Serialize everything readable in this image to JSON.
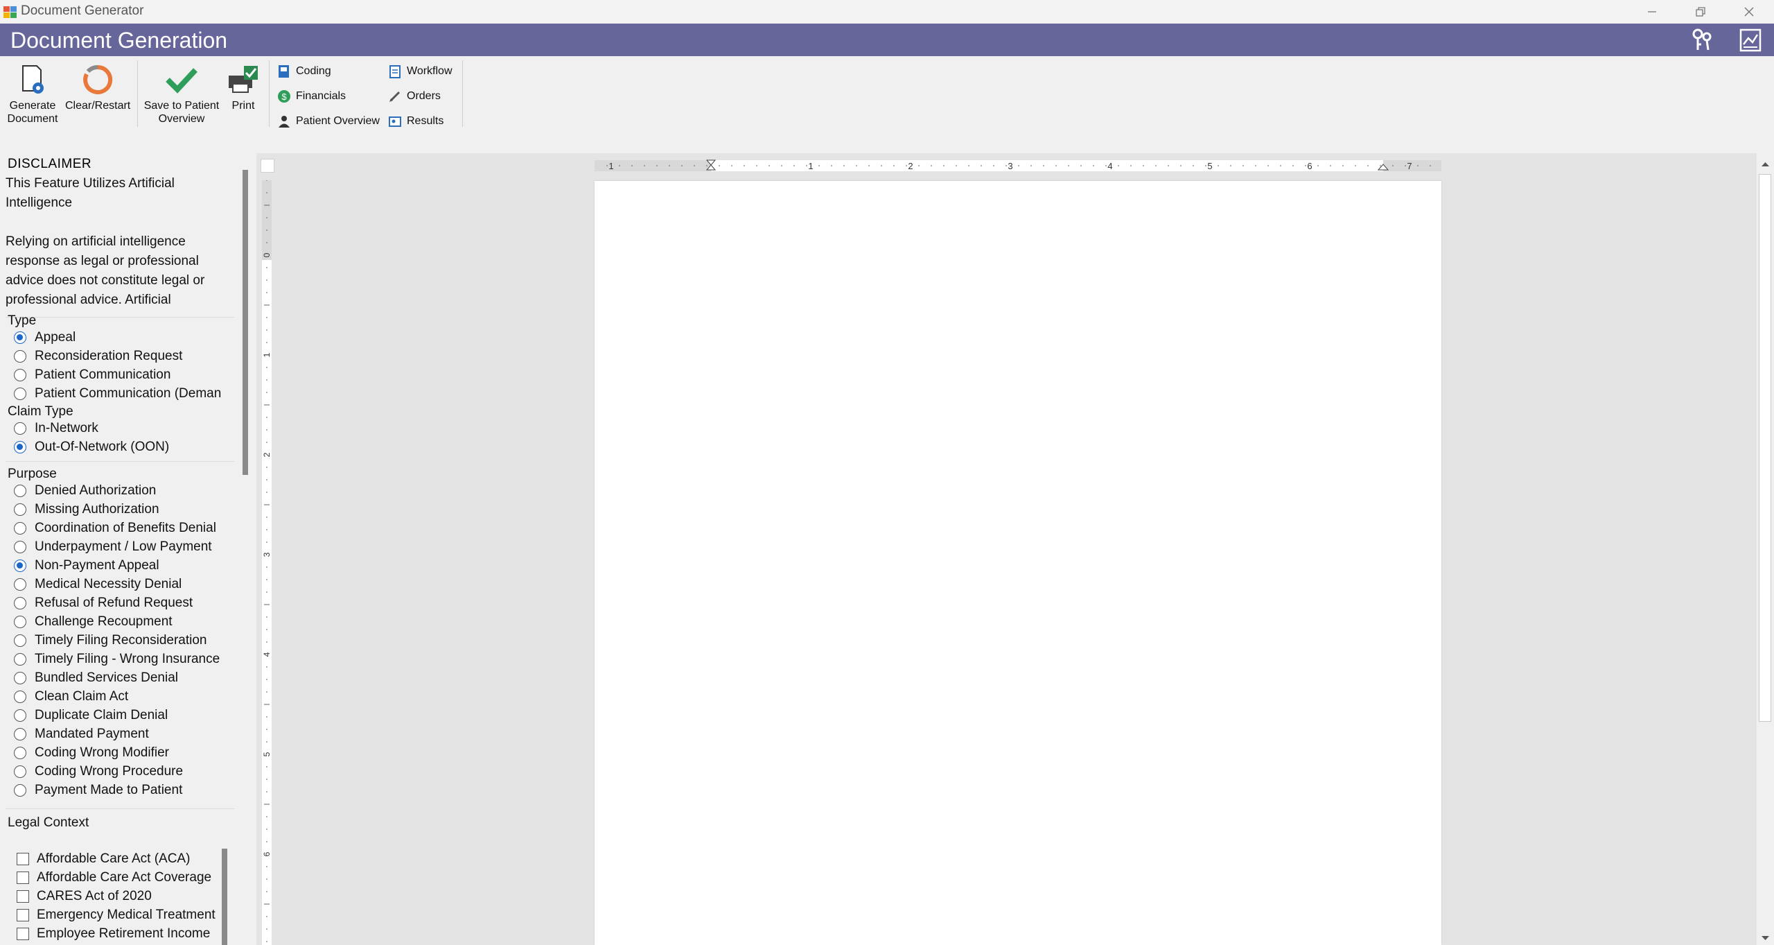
{
  "window": {
    "title": "Document Generator"
  },
  "header": {
    "title": "Document Generation"
  },
  "toolbar": {
    "generate_label": "Generate\nDocument",
    "clear_label": "Clear/Restart",
    "save_label": "Save to Patient\nOverview",
    "print_label": "Print",
    "links": {
      "coding": "Coding",
      "financials": "Financials",
      "patient_overview": "Patient Overview",
      "workflow": "Workflow",
      "orders": "Orders",
      "results": "Results"
    }
  },
  "disclaimer": {
    "heading": "DISCLAIMER",
    "text": "This Feature Utilizes Artificial Intelligence\n\nRelying on artificial intelligence response as legal or professional advice does not constitute legal or professional advice. Artificial"
  },
  "type": {
    "label": "Type",
    "options": [
      {
        "label": "Appeal",
        "selected": true
      },
      {
        "label": "Reconsideration Request",
        "selected": false
      },
      {
        "label": "Patient Communication",
        "selected": false
      },
      {
        "label": "Patient Communication (Deman",
        "selected": false
      }
    ]
  },
  "claim_type": {
    "label": "Claim Type",
    "options": [
      {
        "label": "In-Network",
        "selected": false
      },
      {
        "label": "Out-Of-Network (OON)",
        "selected": true
      }
    ]
  },
  "purpose": {
    "label": "Purpose",
    "options": [
      {
        "label": "Denied Authorization",
        "selected": false
      },
      {
        "label": "Missing Authorization",
        "selected": false
      },
      {
        "label": "Coordination of Benefits Denial",
        "selected": false
      },
      {
        "label": "Underpayment / Low Payment",
        "selected": false
      },
      {
        "label": "Non-Payment Appeal",
        "selected": true
      },
      {
        "label": "Medical Necessity Denial",
        "selected": false
      },
      {
        "label": "Refusal of Refund Request",
        "selected": false
      },
      {
        "label": "Challenge Recoupment",
        "selected": false
      },
      {
        "label": "Timely Filing Reconsideration",
        "selected": false
      },
      {
        "label": "Timely Filing - Wrong Insurance",
        "selected": false
      },
      {
        "label": "Bundled Services Denial",
        "selected": false
      },
      {
        "label": "Clean Claim Act",
        "selected": false
      },
      {
        "label": "Duplicate Claim Denial",
        "selected": false
      },
      {
        "label": "Mandated Payment",
        "selected": false
      },
      {
        "label": "Coding Wrong Modifier",
        "selected": false
      },
      {
        "label": "Coding Wrong Procedure",
        "selected": false
      },
      {
        "label": "Payment Made to Patient",
        "selected": false
      }
    ]
  },
  "legal_context": {
    "label": "Legal Context",
    "items": [
      {
        "label": "Affordable Care Act (ACA)",
        "checked": false
      },
      {
        "label": "Affordable Care Act Coverage",
        "checked": false
      },
      {
        "label": "CARES Act of 2020",
        "checked": false
      },
      {
        "label": "Emergency Medical Treatment",
        "checked": false
      },
      {
        "label": "Employee Retirement Income",
        "checked": false
      }
    ]
  },
  "ruler": {
    "h_labels": [
      "1",
      "1",
      "2",
      "3",
      "4",
      "5",
      "6",
      "7"
    ],
    "v_labels": [
      "0",
      "1",
      "2",
      "3",
      "4",
      "5",
      "6"
    ]
  },
  "colors": {
    "header": "#66669a",
    "accent": "#1b66c9"
  }
}
